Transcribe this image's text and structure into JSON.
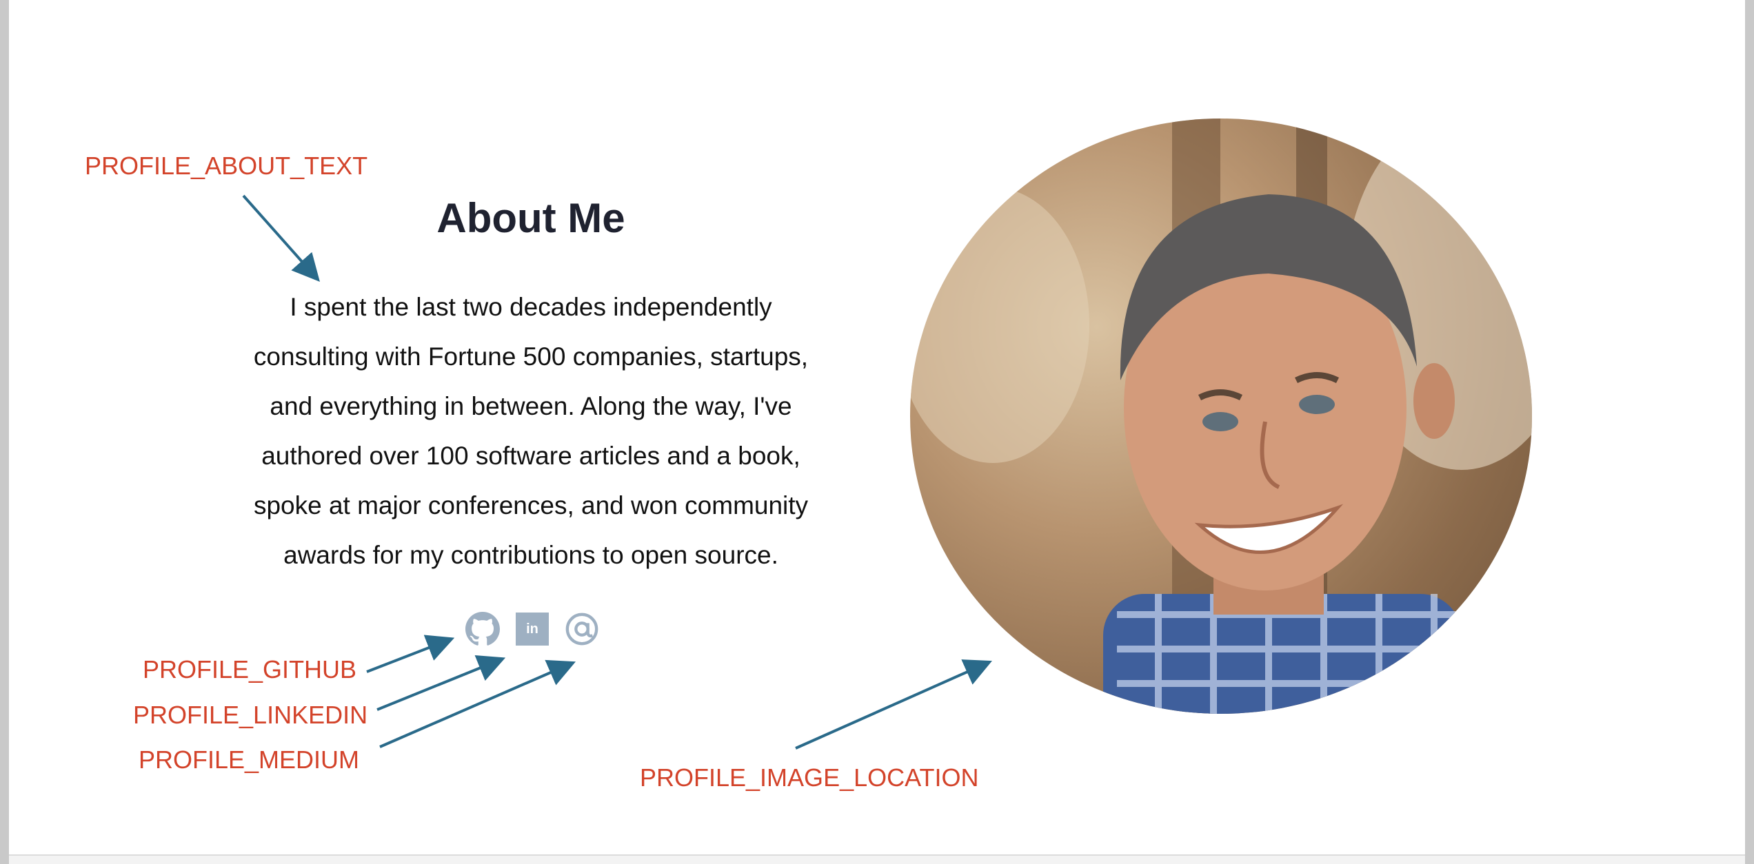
{
  "about": {
    "heading": "About Me",
    "lines": [
      "I spent the last two decades independently",
      "consulting with Fortune 500 companies, startups,",
      "and everything in between. Along the way, I've",
      "authored over 100 software articles and a book,",
      "spoke at major conferences, and won community",
      "awards for my contributions to open source."
    ]
  },
  "social": {
    "linkedin_label": "in",
    "icon_color": "#9eb0c2",
    "icons": [
      "github-icon",
      "linkedin-icon",
      "email-at-icon"
    ]
  },
  "annotations": {
    "about_text": "PROFILE_ABOUT_TEXT",
    "github": "PROFILE_GITHUB",
    "linkedin": "PROFILE_LINKEDIN",
    "medium": "PROFILE_MEDIUM",
    "image_location": "PROFILE_IMAGE_LOCATION",
    "color": "#d3432a",
    "arrow_color": "#2a6a8a"
  }
}
